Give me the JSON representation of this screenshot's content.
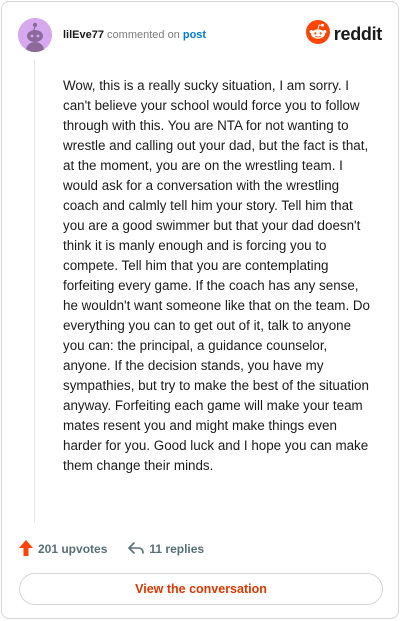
{
  "header": {
    "username": "lilEve77",
    "action_text": " commented on ",
    "post_link": "post",
    "brand": "reddit",
    "brand_color": "#ff4500"
  },
  "comment": {
    "body": "Wow, this is a really sucky situation, I am sorry. I can't believe your school would force you to follow through with this. You are NTA for not wanting to wrestle and calling out your dad, but the fact is that, at the moment, you are on the wrestling team. I would ask for a conversation with the wrestling coach and calmly tell him your story. Tell him that you are a good swimmer but that your dad doesn't think it is manly enough and is forcing you to compete. Tell him that you are contemplating forfeiting every game. If the coach has any sense, he wouldn't want someone like that on the team. Do everything you can to get out of it, talk to anyone you can: the principal, a guidance counselor, anyone. If the decision stands, you have my sympathies, but try to make the best of the situation anyway. Forfeiting each game will make your team mates resent you and might make things even harder for you. Good luck and I hope you can make them change their minds."
  },
  "actions": {
    "upvotes_label": "201 upvotes",
    "replies_label": "11 replies"
  },
  "cta": {
    "label": "View the conversation"
  },
  "icons": {
    "avatar": "snoo-avatar-icon",
    "brand_logo": "reddit-snoo-icon",
    "upvote": "upvote-arrow-icon",
    "reply": "reply-arrow-icon"
  },
  "colors": {
    "upvote": "#ff4500",
    "cta_text": "#d93900",
    "avatar_bg": "#d6a9ee"
  }
}
